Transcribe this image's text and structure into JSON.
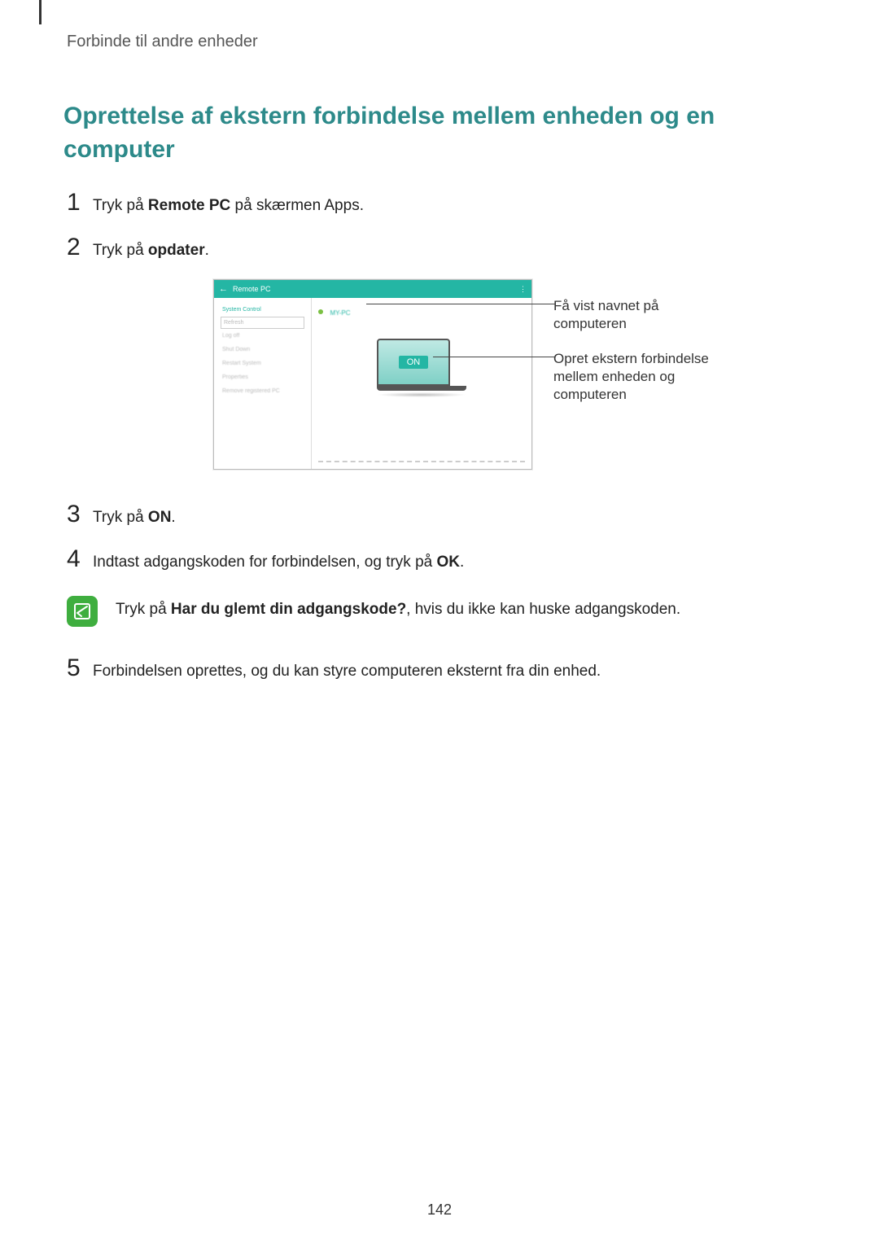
{
  "header": {
    "section_label": "Forbinde til andre enheder"
  },
  "title": "Oprettelse af ekstern forbindelse mellem enheden og en computer",
  "steps": {
    "s1": {
      "num": "1",
      "pre": "Tryk på ",
      "bold": "Remote PC",
      "post": " på skærmen Apps."
    },
    "s2": {
      "num": "2",
      "pre": "Tryk på ",
      "bold": "opdater",
      "post": "."
    },
    "s3": {
      "num": "3",
      "pre": "Tryk på ",
      "bold": "ON",
      "post": "."
    },
    "s4": {
      "num": "4",
      "pre": "Indtast adgangskoden for forbindelsen, og tryk på ",
      "bold": "OK",
      "post": "."
    },
    "s5": {
      "num": "5",
      "text": "Forbindelsen oprettes, og du kan styre computeren eksternt fra din enhed."
    }
  },
  "note": {
    "pre": "Tryk på ",
    "bold": "Har du glemt din adgangskode?",
    "post": ", hvis du ikke kan huske adgangskoden."
  },
  "figure": {
    "titlebar_app": "Remote PC",
    "sidebar_items": [
      "System Control",
      "Refresh",
      "Log off",
      "Shut Down",
      "Restart System",
      "Properties",
      "Remove registered PC"
    ],
    "pc_label": "MY-PC",
    "on_label": "ON",
    "callout1": "Få vist navnet på computeren",
    "callout2": "Opret ekstern forbindelse mellem enheden og computeren"
  },
  "page_number": "142"
}
